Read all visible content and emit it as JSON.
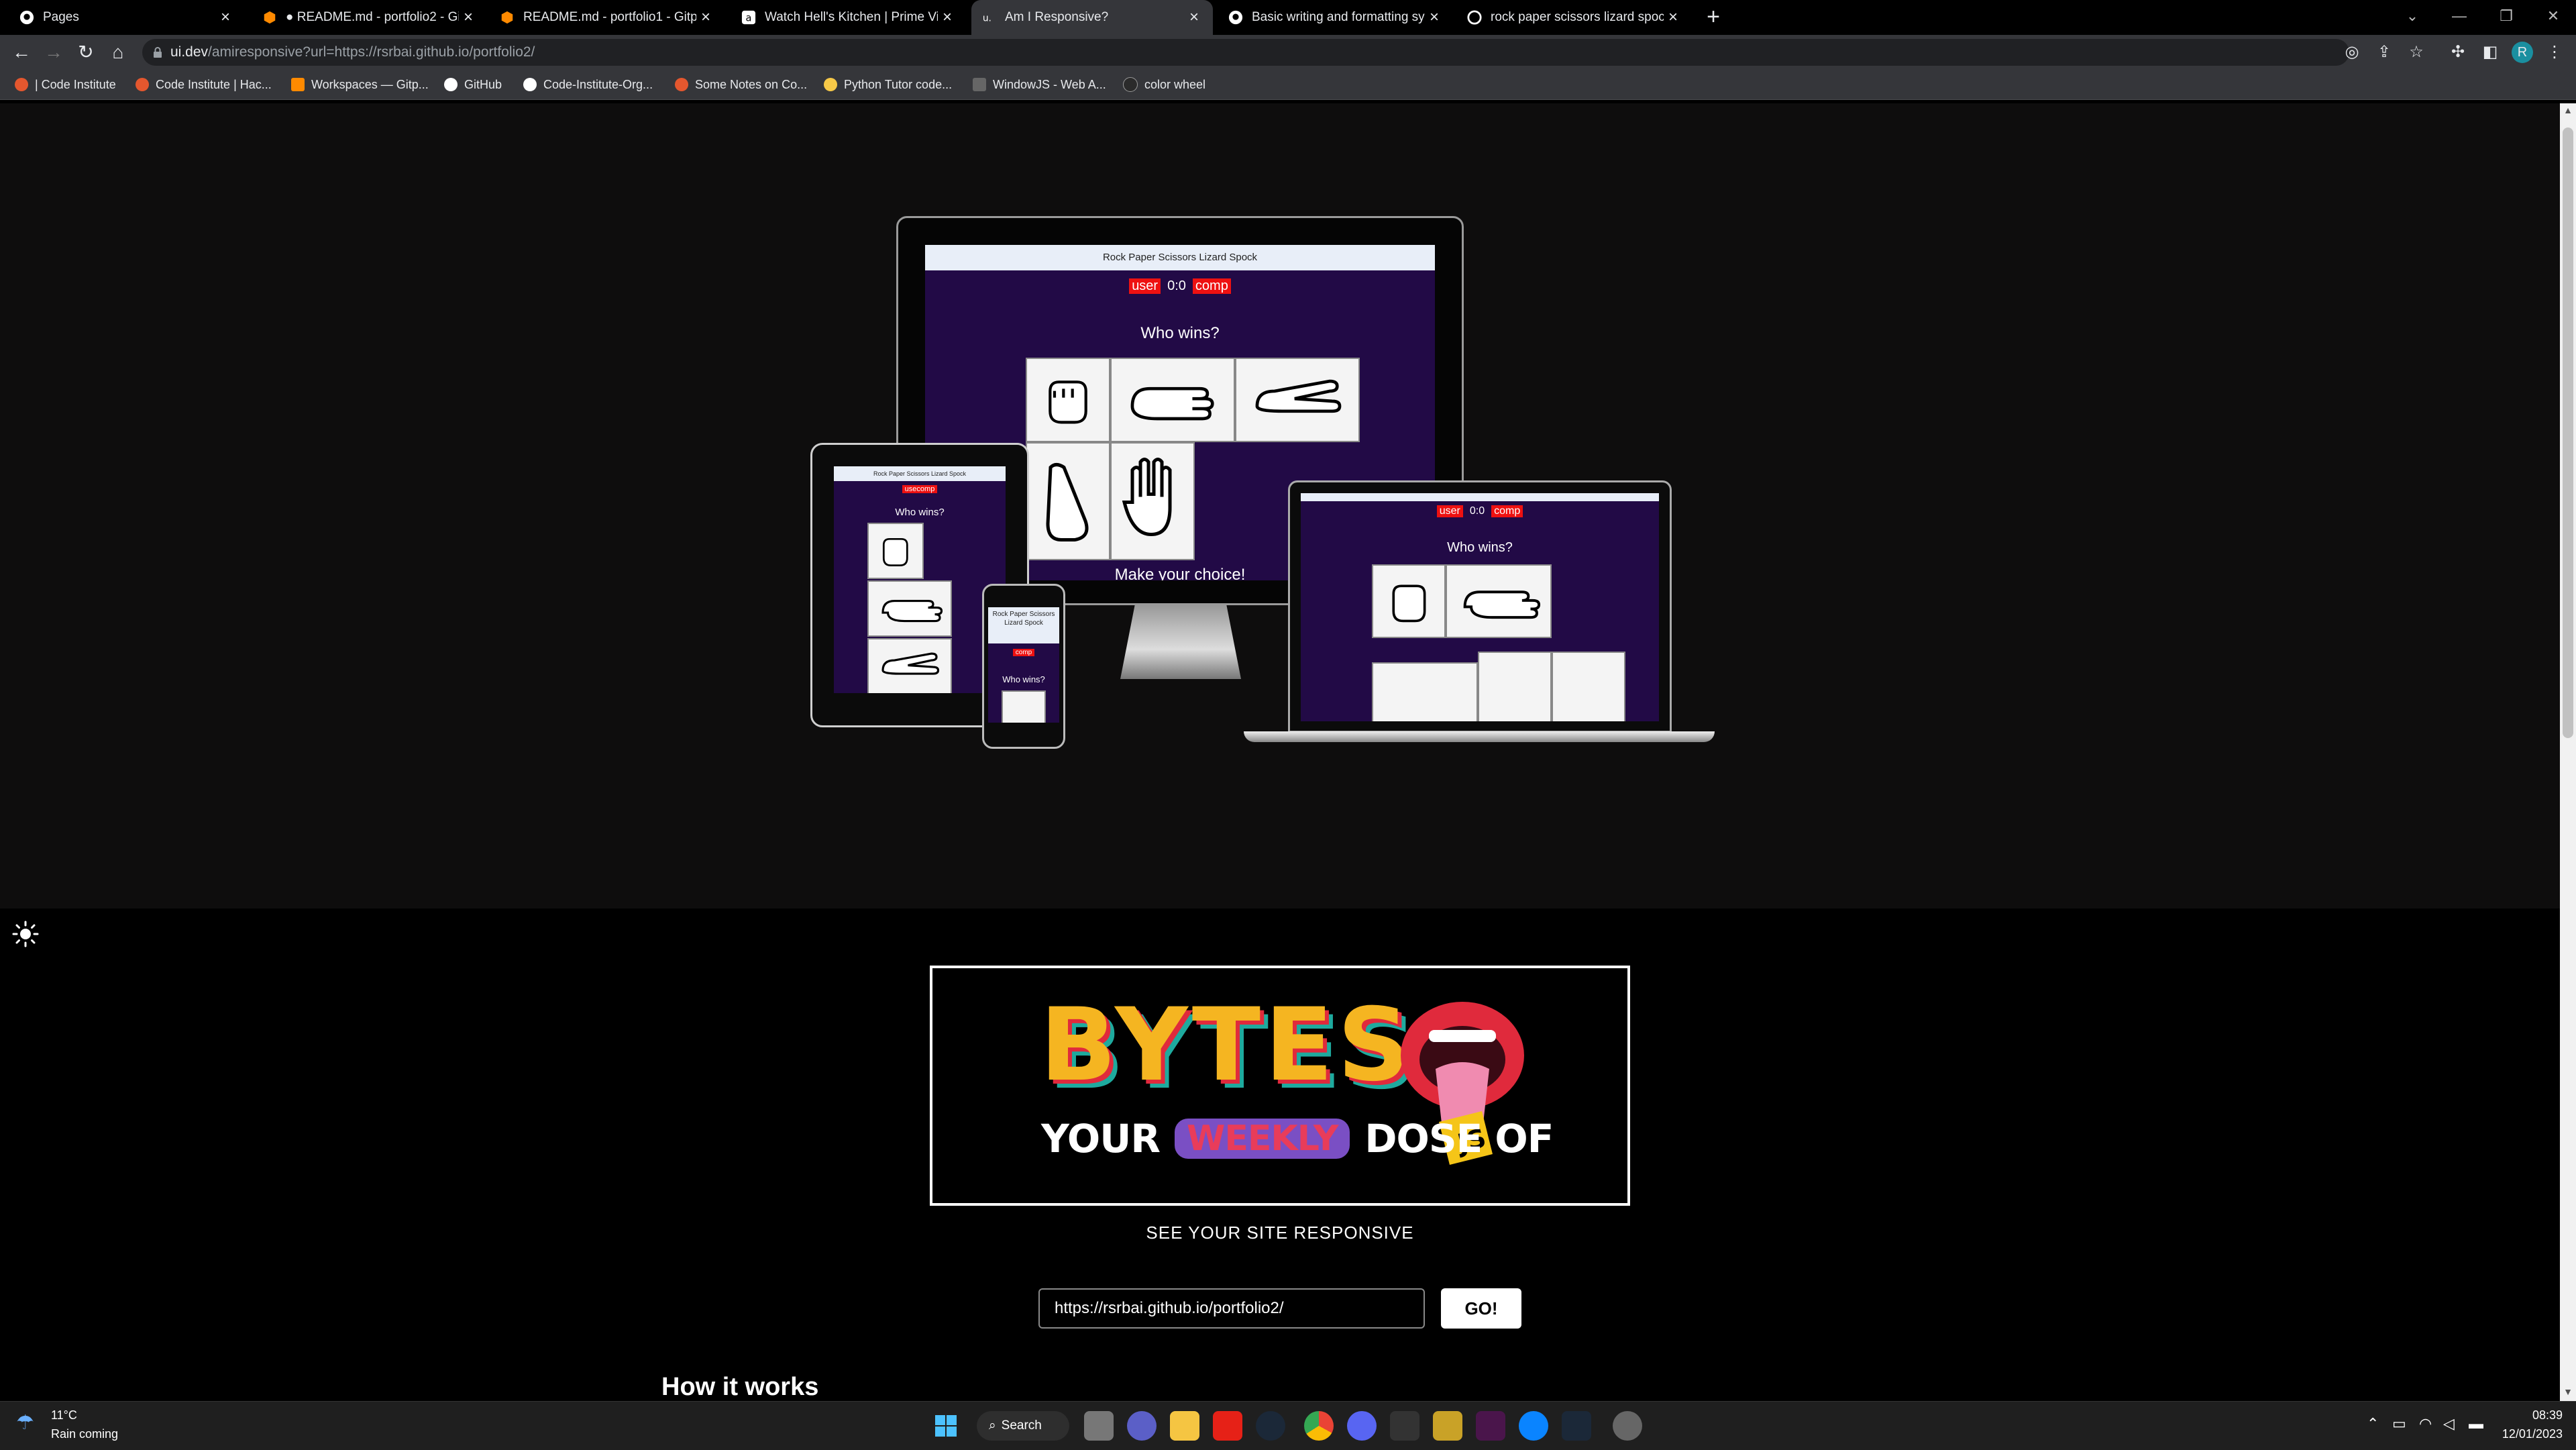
{
  "browser": {
    "tabs": [
      {
        "title": "Pages",
        "active": false
      },
      {
        "title": "● README.md - portfolio2 - Gitpod",
        "active": false
      },
      {
        "title": "README.md - portfolio1 - Gitpod",
        "active": false
      },
      {
        "title": "Watch Hell's Kitchen | Prime Video",
        "active": false
      },
      {
        "title": "Am I Responsive?",
        "active": true
      },
      {
        "title": "Basic writing and formatting syntax",
        "active": false
      },
      {
        "title": "rock paper scissors lizard spock",
        "active": false
      }
    ],
    "close_glyph": "×",
    "new_tab_glyph": "+",
    "address": {
      "host": "ui.dev",
      "rest": "/amiresponsive?url=https://rsrbai.github.io/portfolio2/"
    },
    "bookmarks": [
      "| Code Institute",
      "Code Institute | Hac...",
      "Workspaces — Gitp...",
      "GitHub",
      "Code-Institute-Org...",
      "Some Notes on Co...",
      "Python Tutor code...",
      "WindowJS - Web A...",
      "color wheel"
    ],
    "profile_initial": "R"
  },
  "preview": {
    "game_title": "Rock Paper Scissors Lizard Spock",
    "game_title_phone": "Rock Paper Scissors Lizard Spock",
    "user_label": "user",
    "comp_label": "comp",
    "usercomp": "usecomp",
    "score": "0:0",
    "who_wins": "Who wins?",
    "make_choice": "Make your choice!"
  },
  "banner": {
    "big": "BYTES",
    "your": "YOUR",
    "weekly": "WEEKLY",
    "dose": "DOSE OF",
    "js": "JS"
  },
  "main": {
    "see_label": "SEE YOUR SITE RESPONSIVE",
    "url_value": "https://rsrbai.github.io/portfolio2/",
    "go_label": "GO!",
    "how_title": "How it works"
  },
  "taskbar": {
    "weather_temp": "11°C",
    "weather_desc": "Rain coming",
    "search_label": "Search",
    "time": "08:39",
    "date": "12/01/2023"
  },
  "colors": {
    "game_bg": "#220a46",
    "pill": "#ee1111",
    "bytes_yellow": "#f5b521",
    "weekly_purple": "#7a4fc4"
  }
}
